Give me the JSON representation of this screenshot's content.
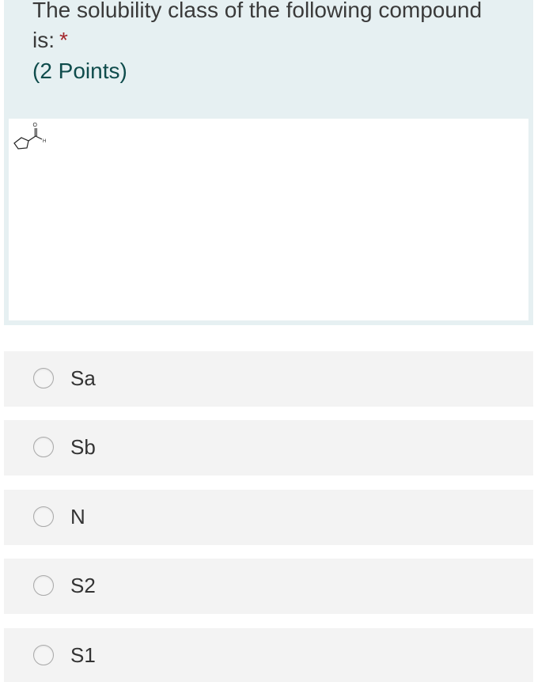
{
  "question": {
    "title": "The solubility class of the following compound is:",
    "required_marker": "*",
    "points": "(2 Points)"
  },
  "image": {
    "atom_oxygen": "O",
    "atom_hydrogen": "H"
  },
  "choices": [
    {
      "label": "Sa",
      "selected": false
    },
    {
      "label": "Sb",
      "selected": false
    },
    {
      "label": "N",
      "selected": false
    },
    {
      "label": "S2",
      "selected": false
    },
    {
      "label": "S1",
      "selected": false
    }
  ],
  "colors": {
    "card_background": "#e6f0f2",
    "choice_background": "#f3f3f3",
    "required": "#a4262c",
    "points_text": "#0f4c4c"
  }
}
